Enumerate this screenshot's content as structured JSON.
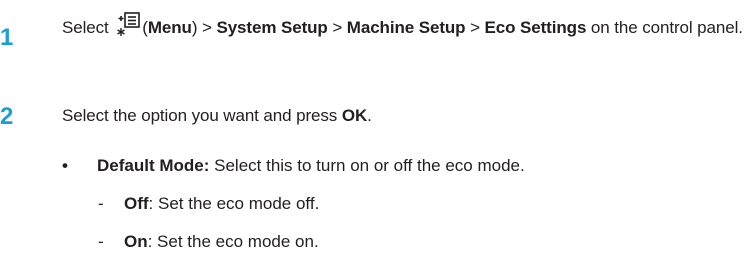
{
  "steps": [
    {
      "number": "1",
      "text": {
        "pre_select": "Select",
        "menu_open": "(",
        "menu_label": "Menu",
        "menu_close": ")",
        "sep": ">",
        "path1": "System Setup",
        "path2": "Machine Setup",
        "path3": "Eco Settings",
        "post": "on the control panel."
      },
      "icon": "menu-icon"
    },
    {
      "number": "2",
      "text": {
        "pre": "Select the option you want and press",
        "key": "OK",
        "post": "."
      }
    }
  ],
  "bullet": {
    "mark": "•",
    "label": "Default Mode:",
    "text": "Select this to turn on or off the eco mode."
  },
  "sub_items": [
    {
      "mark": "-",
      "label": "Off",
      "text": ": Set the eco mode off."
    },
    {
      "mark": "-",
      "label": "On",
      "text": ": Set the eco mode on."
    }
  ],
  "colors": {
    "step_number": "#1a9fd0",
    "text": "#231f20"
  }
}
